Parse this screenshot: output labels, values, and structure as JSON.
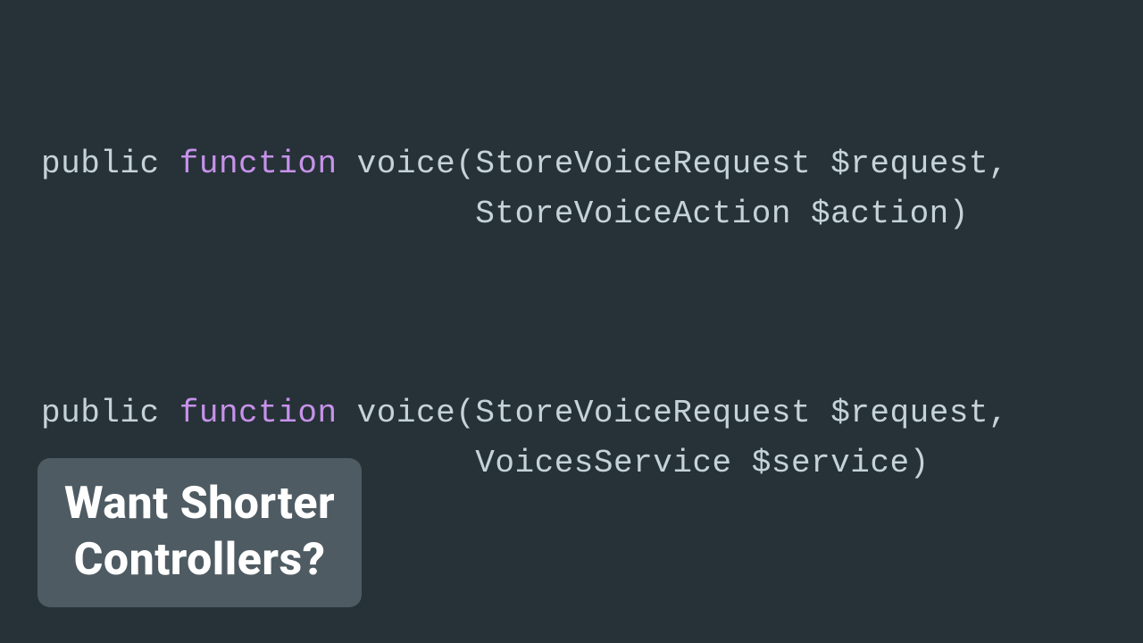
{
  "code": {
    "block1": {
      "visibility": "public",
      "keyword": "function",
      "name": "voice",
      "param1_type": "StoreVoiceRequest",
      "param1_var": "$request",
      "param2_type": "StoreVoiceAction",
      "param2_var": "$action",
      "indent2": "                      "
    },
    "block2": {
      "visibility": "public",
      "keyword": "function",
      "name": "voice",
      "param1_type": "StoreVoiceRequest",
      "param1_var": "$request",
      "param2_type": "VoicesService",
      "param2_var": "$service",
      "indent2": "                      "
    }
  },
  "badge": {
    "line1": "Want Shorter",
    "line2": "Controllers?"
  }
}
